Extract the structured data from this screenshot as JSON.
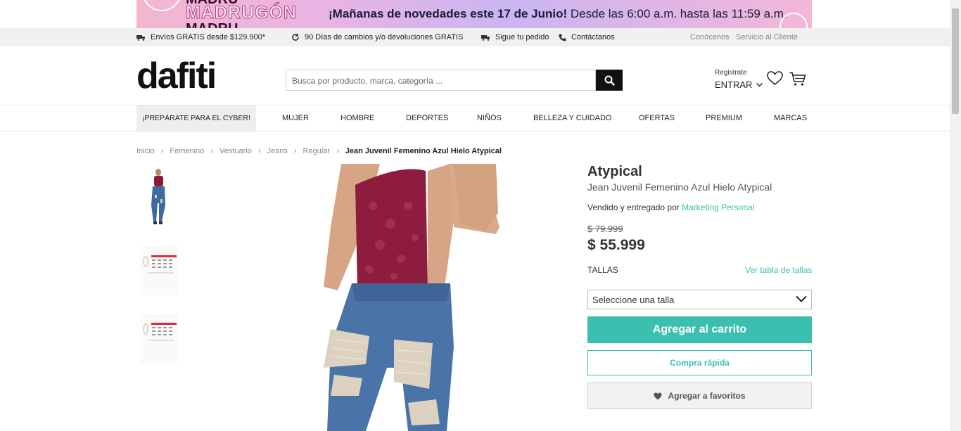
{
  "promo": {
    "brand_word": "MADRUGÓN",
    "brand_echo": "MADRU",
    "message_bold": "¡Mañanas de novedades este 17 de Junio!",
    "message_rest": " Desde las 6:00 a.m. hasta las 11:59 a.m."
  },
  "topbar": {
    "shipping": "Envíos GRATIS desde $129.900*",
    "returns": "90 Días de cambios y/o devoluciones GRATIS",
    "track": "Sigue tu pedido",
    "contact": "Contáctanos",
    "about": "Conócenos",
    "service": "Servicio al Cliente"
  },
  "header": {
    "logo": "dafiti",
    "search_placeholder": "Busca por producto, marca, categoría ...",
    "register": "Registrate",
    "login": "ENTRAR"
  },
  "nav": {
    "items": [
      "¡PREPÁRATE PARA EL CYBER!",
      "MUJER",
      "HOMBRE",
      "DEPORTES",
      "NIÑOS",
      "BELLEZA Y CUIDADO",
      "OFERTAS",
      "PREMIUM",
      "MARCAS"
    ]
  },
  "breadcrumb": {
    "items": [
      "Inicio",
      "Femenino",
      "Vestuario",
      "Jeans",
      "Regular"
    ],
    "current": "Jean Juvenil Femenino Azul Hielo Atypical"
  },
  "product": {
    "brand": "Atypical",
    "name": "Jean Juvenil Femenino Azul Hielo Atypical",
    "seller_prefix": "Vendido y entregado por ",
    "seller_name": "Marketing Personal",
    "old_price": "$ 79.999",
    "price": "$ 55.999",
    "sizes_label": "TALLAS",
    "sizes_guide": "Ver tabla de tallas",
    "size_select": "Seleccione una talla",
    "add_to_cart": "Agregar al carrito",
    "quick_buy": "Compra rápida",
    "add_favorite": "Agregar a favoritos"
  },
  "colors": {
    "accent": "#3bbfae",
    "dark": "#111111",
    "top_bar_bg": "#f0f0f0"
  }
}
